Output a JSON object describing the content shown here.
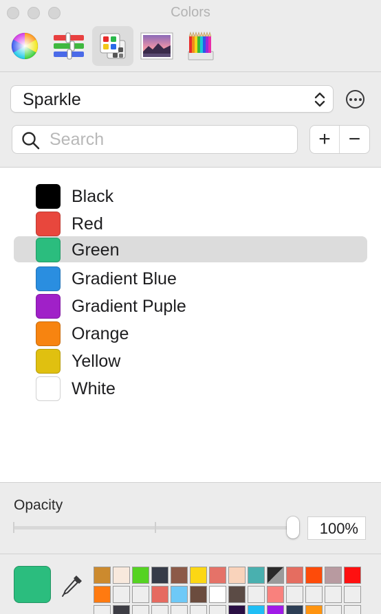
{
  "window": {
    "title": "Colors"
  },
  "toolbar": {
    "tabs": [
      {
        "name": "color-wheel",
        "selected": false
      },
      {
        "name": "color-sliders",
        "selected": false
      },
      {
        "name": "color-palettes",
        "selected": true
      },
      {
        "name": "image-palettes",
        "selected": false
      },
      {
        "name": "pencils",
        "selected": false
      }
    ]
  },
  "palette": {
    "selected": "Sparkle"
  },
  "search": {
    "placeholder": "Search",
    "value": ""
  },
  "list_actions": {
    "add_label": "+",
    "remove_label": "−"
  },
  "colors": [
    {
      "name": "Black",
      "hex": "#000000"
    },
    {
      "name": "Red",
      "hex": "#e8473d"
    },
    {
      "name": "Green",
      "hex": "#2bbd7e",
      "selected": true
    },
    {
      "name": "Gradient Blue",
      "hex": "#2a8ee0"
    },
    {
      "name": "Gradient Puple",
      "hex": "#a020c8"
    },
    {
      "name": "Orange",
      "hex": "#f78410"
    },
    {
      "name": "Yellow",
      "hex": "#e0c010"
    },
    {
      "name": "White",
      "hex": "#ffffff"
    }
  ],
  "opacity": {
    "label": "Opacity",
    "value_text": "100%",
    "value": 1.0
  },
  "current_color": "#2bbd7e",
  "swatches": [
    [
      "#cc8a2e",
      "#f8e9dd",
      "#55d322",
      "#363b48",
      "#8c5a48",
      "#fcd714",
      "#e57268",
      "#f9d3bb",
      "#49b0af",
      "#3a3f44",
      "#e56d60",
      "#fe4b09",
      "#b89aa0",
      "#ff1010"
    ],
    [
      "#ff7a10",
      "#eeeeee",
      "#eeeeee",
      "#e66a60",
      "#6ec9f7",
      "#6b4c3e",
      "#ffffff",
      "#5b4b45",
      "#eeeeee",
      "#f9817d",
      "#eeeeee",
      "#eeeeee",
      "#eeeeee",
      "#eeeeee"
    ],
    [
      "#eeeeee",
      "#3d3d44",
      "#eeeeee",
      "#eeeeee",
      "#eeeeee",
      "#eeeeee",
      "#eeeeee",
      "#2a0f44",
      "#1fbef5",
      "#a01ae8",
      "#2d3e55",
      "#ff9410",
      "#eeeeee",
      "#eeeeee"
    ]
  ]
}
